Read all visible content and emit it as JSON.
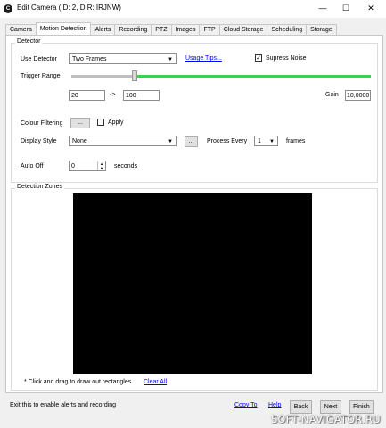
{
  "window": {
    "icon_letter": "C",
    "title": "Edit Camera (ID: 2, DIR: IRJNW)",
    "minimize": "—",
    "maximize": "☐",
    "close": "✕"
  },
  "tabs": [
    {
      "label": "Camera"
    },
    {
      "label": "Motion Detection",
      "active": true
    },
    {
      "label": "Alerts"
    },
    {
      "label": "Recording"
    },
    {
      "label": "PTZ"
    },
    {
      "label": "Images"
    },
    {
      "label": "FTP"
    },
    {
      "label": "Cloud Storage"
    },
    {
      "label": "Scheduling"
    },
    {
      "label": "Storage"
    }
  ],
  "detector": {
    "group_title": "Detector",
    "use_detector_label": "Use Detector",
    "use_detector_value": "Two Frames",
    "usage_tips": "Usage Tips...",
    "supress_noise_label": "Supress Noise",
    "supress_noise_checked": true,
    "trigger_range_label": "Trigger Range",
    "trigger_range_position": 0.21,
    "range_min": "20",
    "range_arrow": "->",
    "range_max": "100",
    "gain_label": "Gain",
    "gain_value": "10,0000",
    "colour_filtering_label": "Colour Filtering",
    "colour_button": "...",
    "apply_label": "Apply",
    "apply_checked": false,
    "display_style_label": "Display Style",
    "display_style_value": "None",
    "display_style_button": "...",
    "process_every_label": "Process Every",
    "process_every_value": "1",
    "frames_label": "frames",
    "auto_off_label": "Auto Off",
    "auto_off_value": "0",
    "seconds_label": "seconds"
  },
  "zones": {
    "group_title": "Detection Zones",
    "hint": "* Click and drag to draw out rectangles",
    "clear_all": "Clear All"
  },
  "footer": {
    "status": "Exit this to enable alerts and recording",
    "copy_to": "Copy To",
    "help": "Help",
    "back": "Back",
    "next": "Next",
    "finish": "Finish"
  },
  "watermark": "SOFT-NAVIGATOR.RU",
  "colors": {
    "slider_fill": "#3ccf52",
    "link": "#0000ee",
    "canvas": "#000000"
  }
}
